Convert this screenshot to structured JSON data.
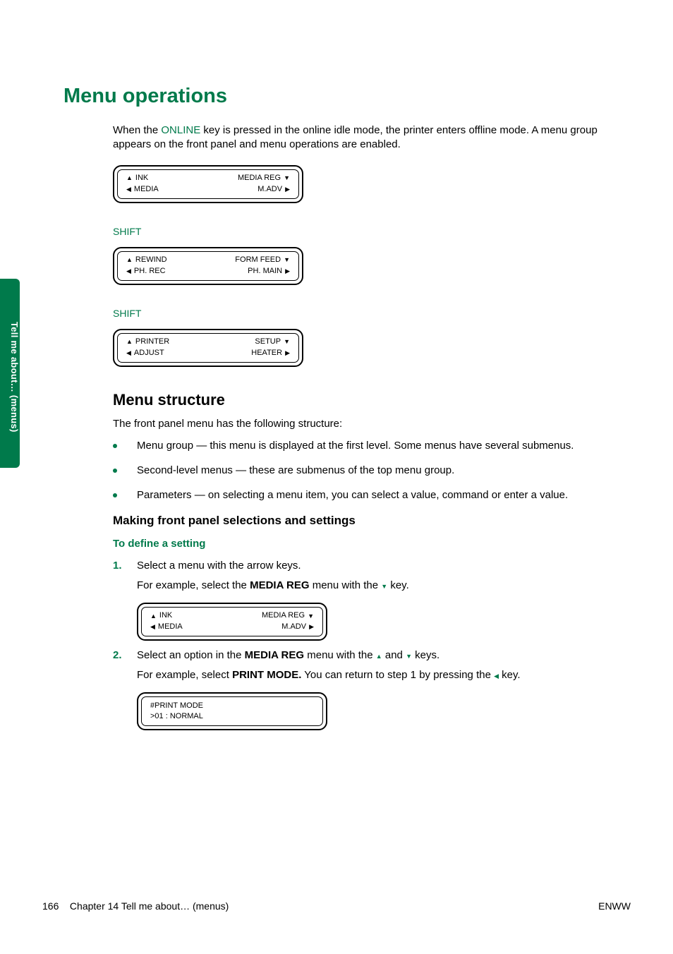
{
  "sidebar": {
    "label": "Tell me about… (menus)"
  },
  "title": "Menu operations",
  "intro_pre": "When the ",
  "intro_online": "ONLINE",
  "intro_post": " key is pressed in the online idle mode, the printer enters offline mode. A menu group appears on the front panel and menu operations are enabled.",
  "lcd1": {
    "r1l": "INK",
    "r1r": "MEDIA REG",
    "r2l": "MEDIA",
    "r2r": "M.ADV"
  },
  "shift1": "SHIFT",
  "lcd2": {
    "r1l": "REWIND",
    "r1r": "FORM FEED",
    "r2l": "PH. REC",
    "r2r": "PH. MAIN"
  },
  "shift2": "SHIFT",
  "lcd3": {
    "r1l": "PRINTER",
    "r1r": "SETUP",
    "r2l": "ADJUST",
    "r2r": "HEATER"
  },
  "structure_heading": "Menu structure",
  "structure_intro": "The front panel menu has the following structure:",
  "bullets": [
    "Menu group — this menu is displayed at the first level. Some menus have several submenus.",
    "Second-level menus — these are submenus of the top menu group.",
    "Parameters — on selecting a menu item, you can select a value, command or enter a value."
  ],
  "making_heading": "Making front panel selections and settings",
  "define_heading": "To define a setting",
  "step1_num": "1.",
  "step1_text": "Select a menu with the arrow keys.",
  "step1_sub_pre": "For example, select the ",
  "step1_sub_bold": "MEDIA REG",
  "step1_sub_mid": " menu with the ",
  "step1_sub_post": " key.",
  "lcd4": {
    "r1l": "INK",
    "r1r": "MEDIA REG",
    "r2l": "MEDIA",
    "r2r": "M.ADV"
  },
  "step2_num": "2.",
  "step2_text_pre": "Select an option in the ",
  "step2_text_bold": "MEDIA REG",
  "step2_text_mid": " menu with the ",
  "step2_text_and": " and ",
  "step2_text_post": " keys.",
  "step2_sub_pre": "For example, select ",
  "step2_sub_bold": "PRINT MODE.",
  "step2_sub_mid": " You can return to step 1 by pressing the ",
  "step2_sub_post": " key.",
  "lcd5": {
    "r1": "#PRINT MODE",
    "r2": ">01 : NORMAL"
  },
  "footer": {
    "page": "166",
    "chapter": "Chapter 14   Tell me about… (menus)",
    "right": "ENWW"
  }
}
